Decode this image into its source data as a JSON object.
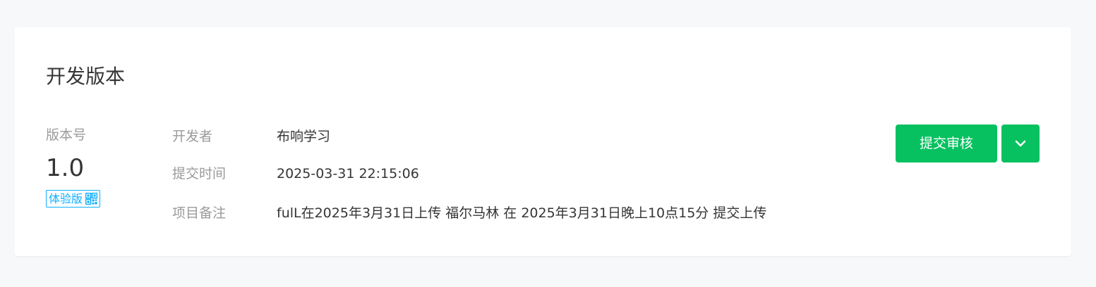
{
  "section": {
    "title": "开发版本"
  },
  "version": {
    "label": "版本号",
    "number": "1.0",
    "badge": "体验版"
  },
  "details": [
    {
      "key": "开发者",
      "value": "布响学习"
    },
    {
      "key": "提交时间",
      "value": "2025-03-31 22:15:06"
    },
    {
      "key": "项目备注",
      "value": "fulL在2025年3月31日上传 福尔马林 在 2025年3月31日晚上10点15分 提交上传"
    }
  ],
  "actions": {
    "submit_label": "提交审核",
    "dropdown_icon": "chevron-down-icon"
  },
  "colors": {
    "accent": "#07c160",
    "badge": "#10aeff",
    "muted_text": "#9a9a9a",
    "text": "#353535",
    "background": "#f7f8fa"
  }
}
